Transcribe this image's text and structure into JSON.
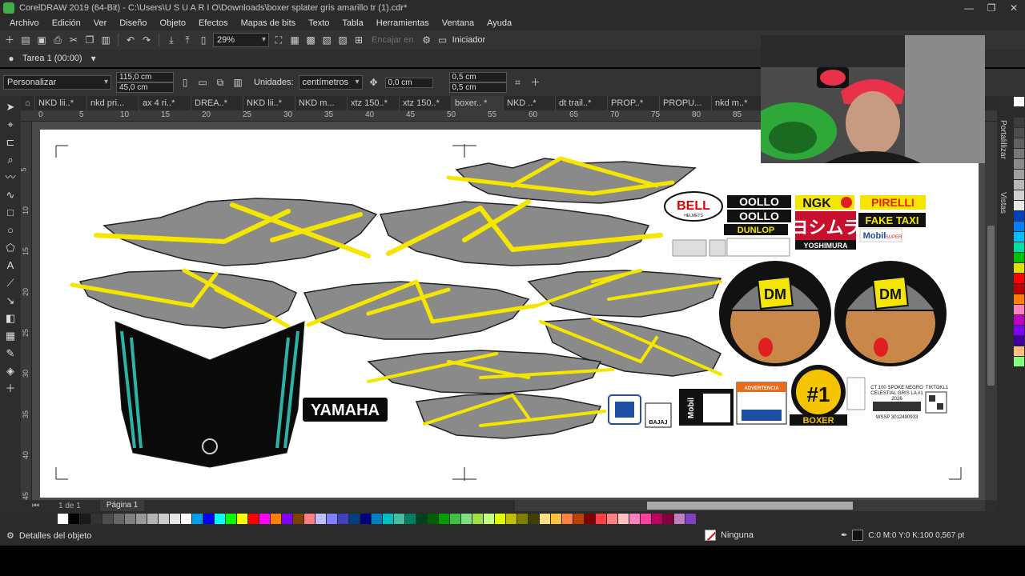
{
  "window": {
    "title": "CorelDRAW 2019 (64-Bit) - C:\\Users\\U S U A R I O\\Downloads\\boxer splater gris amarillo tr (1).cdr*",
    "minimize": "—",
    "maximize": "❐",
    "close": "✕"
  },
  "menu": [
    "Archivo",
    "Edición",
    "Ver",
    "Diseño",
    "Objeto",
    "Efectos",
    "Mapas de bits",
    "Texto",
    "Tabla",
    "Herramientas",
    "Ventana",
    "Ayuda"
  ],
  "toolbar": {
    "zoom": "29%",
    "snap_to": "Encajar en",
    "launcher": "Iniciador"
  },
  "task": {
    "label": "Tarea 1 (00:00)"
  },
  "properties": {
    "preset": "Personalizar",
    "width": "115,0 cm",
    "height": "45,0 cm",
    "units_label": "Unidades:",
    "units_value": "centímetros",
    "nudge": "0,0 cm",
    "dup_x": "0,5 cm",
    "dup_y": "0,5 cm"
  },
  "doc_tabs": [
    "NKD lii..*",
    "nkd pri...",
    "ax 4  ri..*",
    "DREA..*",
    "NKD lii..*",
    "NKD  m...",
    "xtz 150..*",
    "xtz 150..*",
    "boxer.. *",
    "NKD  ..*",
    "dt trail..*",
    "PROP..*",
    "PROPU...",
    "nkd m..*"
  ],
  "ruler_h": [
    "0",
    "5",
    "10",
    "15",
    "20",
    "25",
    "30",
    "35",
    "40",
    "45",
    "50",
    "55",
    "60",
    "65",
    "70",
    "75",
    "80",
    "85"
  ],
  "ruler_v": [
    "5",
    "10",
    "15",
    "20",
    "25",
    "30",
    "35",
    "40",
    "45"
  ],
  "right_dock": {
    "tab1": "Portalillizar",
    "tab2": "Vistas"
  },
  "page_bar": {
    "page_count": "1  de  1",
    "page_tab": "Página 1"
  },
  "status": {
    "object_details": "Detalles del objeto",
    "fill": "Ninguna",
    "outline": "C:0 M:0 Y:0 K:100  0,567 pt"
  },
  "artwork": {
    "yamaha": "YAMAHA",
    "bell": "BELL",
    "bell_sub": "HELMETS",
    "fox": "OOLLO",
    "ngk": "NGK",
    "pirelli": "PIRELLI",
    "dunlop": "DUNLOP",
    "yoshimura": "YOSHIMURA",
    "fake_taxi": "FAKE TAXI",
    "mobil": "Mobil",
    "mobil_sub": "SUPER",
    "dm": "DM",
    "boxer_badge": "#1",
    "boxer": "BOXER",
    "bajaj": "BAJAJ",
    "advertencia": "ADVERTENCIA",
    "spec_line1": "CT 100  SPOKE NEGRO",
    "spec_line2": "CELESTIAL GRIS LA #1",
    "spec_line3": "2026",
    "spec_wssp": "WSSP 3012490933",
    "tiktok": "TIKTOKL1"
  },
  "colors": {
    "accent_yellow": "#f5e600",
    "teal": "#2ab3a6",
    "red": "#e02020",
    "webcam_cap": "#e8324a"
  },
  "palette_h": [
    "#ffffff",
    "#000000",
    "#1a1a1a",
    "#333333",
    "#4d4d4d",
    "#666666",
    "#808080",
    "#999999",
    "#b3b3b3",
    "#cccccc",
    "#e6e6e6",
    "#ffffff",
    "#00a0e9",
    "#0000ff",
    "#00ffff",
    "#00ff00",
    "#ffff00",
    "#ff0000",
    "#ff00ff",
    "#ff8000",
    "#8000ff",
    "#804000",
    "#ff8080",
    "#c0c0ff",
    "#8080ff",
    "#4040c0",
    "#004080",
    "#000080",
    "#0080c0",
    "#00c0c0",
    "#40c0a0",
    "#008060",
    "#004020",
    "#006000",
    "#00a000",
    "#40c040",
    "#80e080",
    "#a0e040",
    "#c0ff80",
    "#e0ff00",
    "#c0c000",
    "#808000",
    "#404000",
    "#ffe080",
    "#ffc040",
    "#ff8040",
    "#c04000",
    "#800000",
    "#ff4040",
    "#ff8080",
    "#ffc0c0",
    "#ff80c0",
    "#ff40a0",
    "#c00060",
    "#800040",
    "#c080c0",
    "#8040c0"
  ],
  "palette_v": [
    "#ffffff",
    "#2a2a2a",
    "#3c3c3c",
    "#4d4d4d",
    "#606060",
    "#777777",
    "#8a8a8a",
    "#a0a0a0",
    "#b8b8b8",
    "#d0d0d0",
    "#e8e8e8",
    "#0040c0",
    "#0080ff",
    "#00c0ff",
    "#00e0a0",
    "#00c000",
    "#e0e000",
    "#ff0000",
    "#c00000",
    "#ff8000",
    "#ff80c0",
    "#c000c0",
    "#8000ff",
    "#4000a0",
    "#ffc080",
    "#80ff80"
  ]
}
